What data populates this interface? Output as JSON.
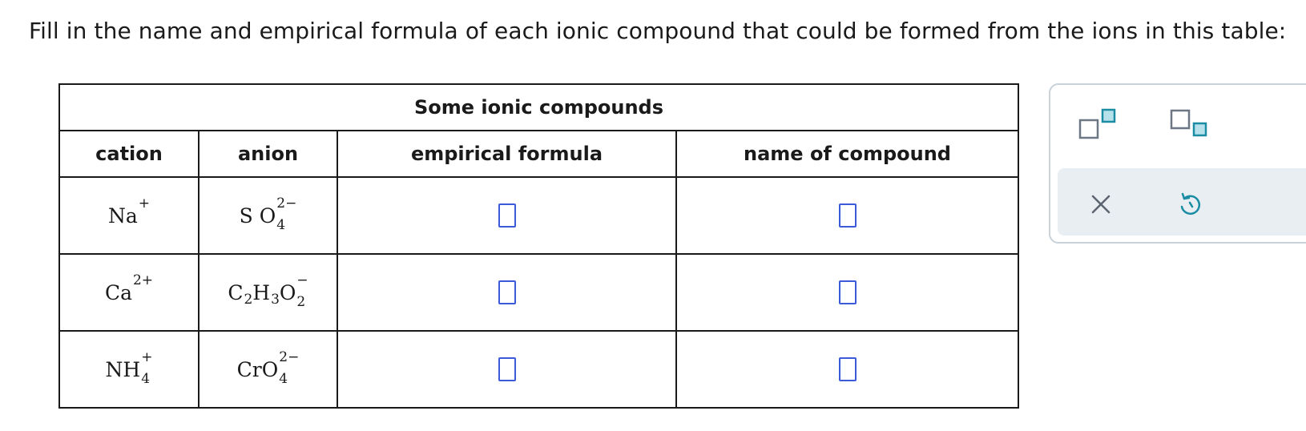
{
  "instructions": "Fill in the name and empirical formula of each ionic compound that could be formed from the ions in this table:",
  "table": {
    "caption": "Some ionic compounds",
    "headers": {
      "cation": "cation",
      "anion": "anion",
      "formula": "empirical formula",
      "name": "name of compound"
    },
    "rows": [
      {
        "cation": {
          "symbol": "Na",
          "charge": "+"
        },
        "anion": {
          "parts": [
            {
              "el": "S O",
              "sub": "4",
              "sup": "2−"
            }
          ]
        }
      },
      {
        "cation": {
          "symbol": "Ca",
          "charge": "2+"
        },
        "anion": {
          "parts": [
            {
              "el": "C",
              "sub": "2"
            },
            {
              "el": "H",
              "sub": "3"
            },
            {
              "el": "O",
              "sub": "2",
              "sup": "−"
            }
          ]
        }
      },
      {
        "cation": {
          "symbol": "NH",
          "sub": "4",
          "charge": "+"
        },
        "anion": {
          "parts": [
            {
              "el": "CrO",
              "sub": "4",
              "sup": "2−"
            }
          ]
        }
      }
    ]
  },
  "toolbar": {
    "icons": [
      "superscript-icon",
      "subscript-icon",
      "clear-icon",
      "undo-icon"
    ],
    "colors": {
      "accent": "#3b5bdb",
      "icon_teal": "#1a8ca3",
      "icon_gray": "#6b7785",
      "panel_border": "#c9d1d9",
      "actions_bg": "#e9eef2"
    }
  }
}
